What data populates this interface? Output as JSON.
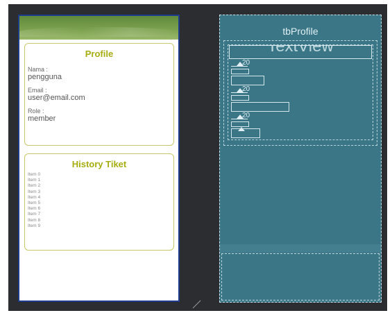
{
  "design": {
    "profile": {
      "title": "Profile",
      "fields": [
        {
          "label": "Nama :",
          "value": "pengguna"
        },
        {
          "label": "Email :",
          "value": "user@email.com"
        },
        {
          "label": "Role :",
          "value": "member"
        }
      ]
    },
    "history": {
      "title": "History Tiket",
      "items": [
        "Item 0",
        "Item 1",
        "Item 2",
        "Item 3",
        "Item 4",
        "Item 5",
        "Item 6",
        "Item 7",
        "Item 8",
        "Item 9"
      ]
    }
  },
  "blueprint": {
    "toolbar_id": "tbProfile",
    "textview_label": "TextView",
    "margin_values": [
      "20",
      "20",
      "20"
    ]
  },
  "colors": {
    "accent_title": "#a6ad10",
    "card_border": "#c8c86a",
    "header_green": "#6e9646",
    "blueprint_bg": "#3b7686",
    "editor_bg": "#2c2d30"
  }
}
